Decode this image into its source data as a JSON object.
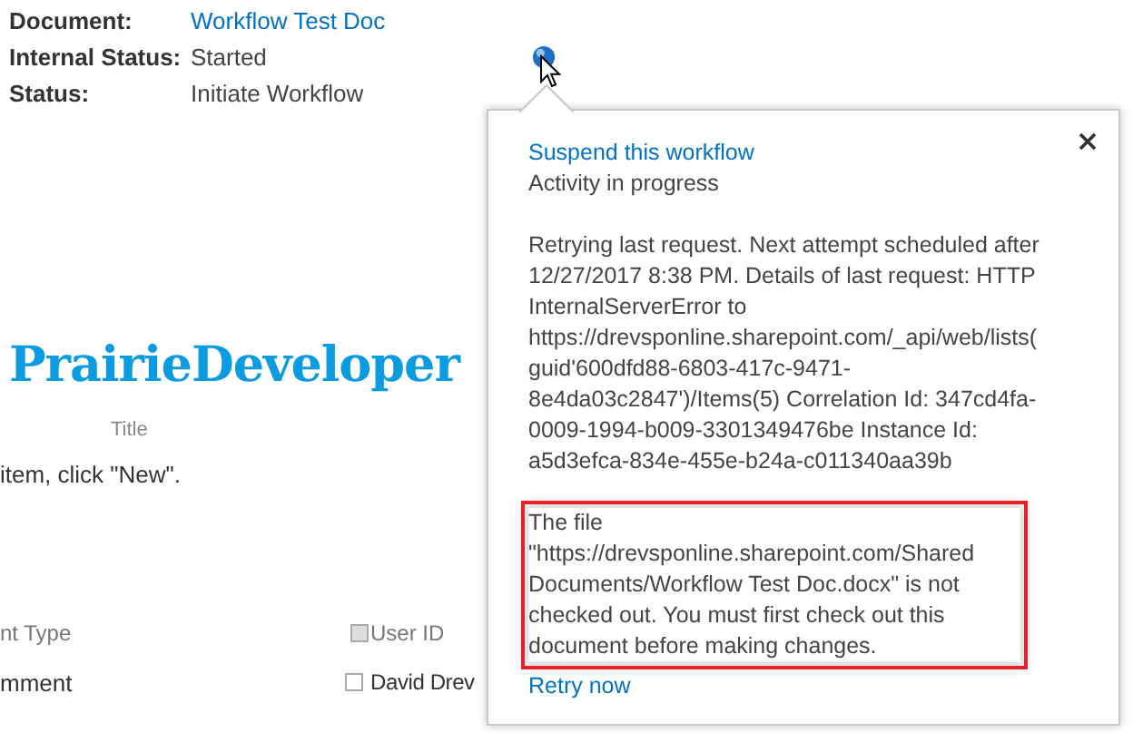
{
  "document_info": [
    {
      "label": "Document:",
      "value": "Workflow Test Doc",
      "kind": "link"
    },
    {
      "label": "Internal Status:",
      "value": "Started",
      "kind": "text"
    },
    {
      "label": "Status:",
      "value": "Initiate Workflow",
      "kind": "text"
    }
  ],
  "logo": "PrairieDeveloper",
  "list": {
    "column_header": "Title",
    "empty_message": "item, click \"New\".",
    "rows": [
      {
        "kind": "header",
        "label": "nt Type",
        "value": "User ID",
        "checked": false
      },
      {
        "kind": "item",
        "label": "mment",
        "value": "David Drev",
        "checked": false
      }
    ]
  },
  "popup": {
    "link": "Suspend this workflow",
    "activity": "Activity in progress",
    "details": "Retrying last request. Next attempt scheduled after 12/27/2017 8:38 PM. Details of last request: HTTP InternalServerError to https://drevsponline.sharepoint.com/_api/web/lists(guid'600dfd88-6803-417c-9471-8e4da03c2847')/Items(5) Correlation Id: 347cd4fa-0009-1994-b009-3301349476be Instance Id: a5d3efca-834e-455e-b24a-c011340aa39b",
    "error": "The file \"https://drevsponline.sharepoint.com/Shared Documents/Workflow Test Doc.docx\" is not checked out. You must first check out this document before making changes.",
    "retry_link": "Retry now"
  }
}
